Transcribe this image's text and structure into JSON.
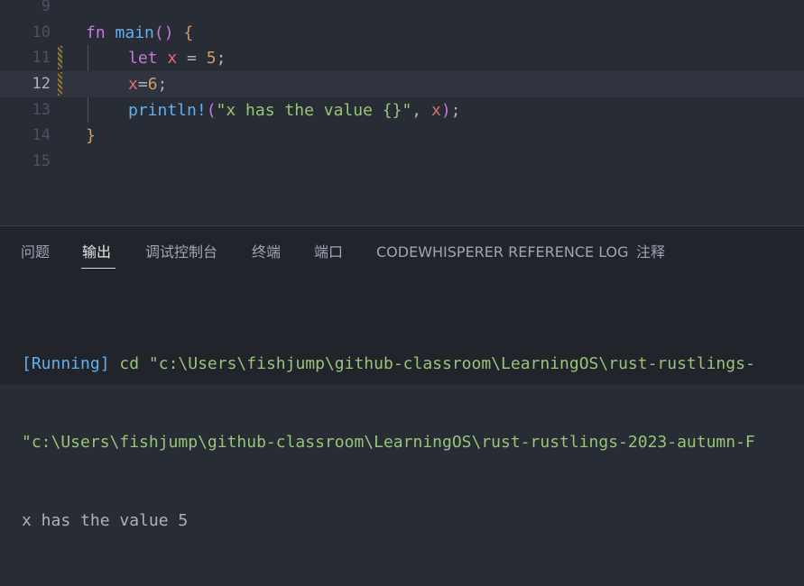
{
  "editor": {
    "lines": [
      {
        "num": "9"
      },
      {
        "num": "10",
        "t1": "fn",
        "t2": " ",
        "t3": "main",
        "t4": "()",
        "t5": " ",
        "t6": "{"
      },
      {
        "num": "11",
        "t1": "let",
        "t2": " ",
        "t3": "x",
        "t4": " = ",
        "t5": "5",
        "t6": ";"
      },
      {
        "num": "12",
        "t1": "x",
        "t2": "=",
        "t3": "6",
        "t4": ";"
      },
      {
        "num": "13",
        "t1": "println!",
        "t2": "(",
        "t3": "\"x has the value {}\"",
        "t4": ", ",
        "t5": "x",
        "t6": ")",
        "t7": ";"
      },
      {
        "num": "14",
        "t1": "}"
      },
      {
        "num": "15"
      }
    ]
  },
  "panel": {
    "tabs": [
      "问题",
      "输出",
      "调试控制台",
      "终端",
      "端口",
      "CODEWHISPERER REFERENCE LOG",
      "注释"
    ],
    "active_tab": "输出",
    "output": {
      "line1_prefix": "[Running]",
      "line1_rest": " cd \"c:\\Users\\fishjump\\github-classroom\\LearningOS\\rust-rustlings-",
      "line2": "\"c:\\Users\\fishjump\\github-classroom\\LearningOS\\rust-rustlings-2023-autumn-F",
      "line3": "x has the value 5"
    }
  }
}
